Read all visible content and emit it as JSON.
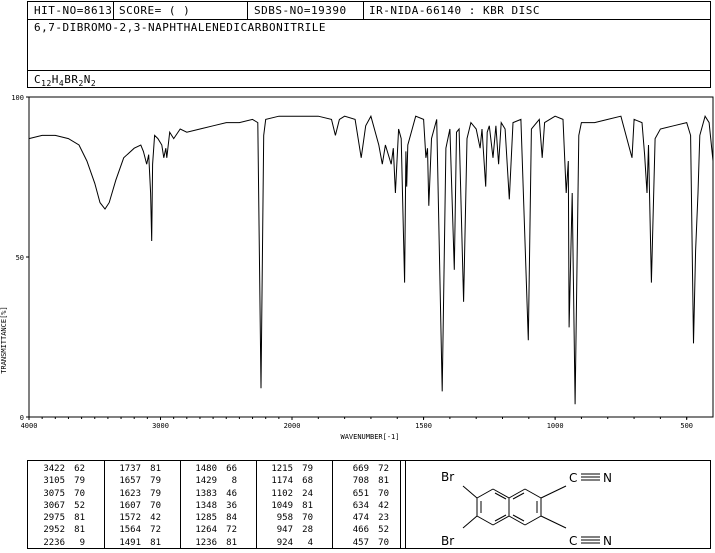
{
  "header": {
    "hit_no": "HIT-NO=8613",
    "score": "SCORE=  (  )",
    "sdbs_no": "SDBS-NO=19390",
    "sample": "IR-NIDA-66140 : KBR DISC",
    "compound_name": "6,7-DIBROMO-2,3-NAPHTHALENEDICARBONITRILE",
    "formula_parts": [
      "C",
      "12",
      "H",
      "4",
      "BR",
      "2",
      "N",
      "2"
    ]
  },
  "chart_data": {
    "type": "line",
    "xlabel": "WAVENUMBER[-1]",
    "ylabel": "TRANSMITTANCE[%]",
    "xlim": [
      4000,
      400
    ],
    "ylim": [
      0,
      100
    ],
    "x_ticks": [
      4000,
      3000,
      2000,
      1500,
      1000,
      500
    ],
    "y_ticks": [
      0,
      50,
      100
    ],
    "series": [
      {
        "points": [
          [
            4000,
            87
          ],
          [
            3900,
            88
          ],
          [
            3800,
            88
          ],
          [
            3700,
            87
          ],
          [
            3620,
            85
          ],
          [
            3560,
            80
          ],
          [
            3500,
            73
          ],
          [
            3460,
            67
          ],
          [
            3422,
            65
          ],
          [
            3390,
            67
          ],
          [
            3340,
            74
          ],
          [
            3280,
            81
          ],
          [
            3200,
            84
          ],
          [
            3150,
            85
          ],
          [
            3130,
            83
          ],
          [
            3105,
            79
          ],
          [
            3090,
            82
          ],
          [
            3075,
            70
          ],
          [
            3067,
            55
          ],
          [
            3060,
            79
          ],
          [
            3045,
            88
          ],
          [
            3020,
            87
          ],
          [
            2990,
            85
          ],
          [
            2975,
            81
          ],
          [
            2960,
            84
          ],
          [
            2952,
            81
          ],
          [
            2930,
            89
          ],
          [
            2900,
            87
          ],
          [
            2850,
            90
          ],
          [
            2800,
            89
          ],
          [
            2700,
            90
          ],
          [
            2600,
            91
          ],
          [
            2500,
            92
          ],
          [
            2400,
            92
          ],
          [
            2300,
            93
          ],
          [
            2260,
            92
          ],
          [
            2236,
            9
          ],
          [
            2215,
            88
          ],
          [
            2200,
            93
          ],
          [
            2100,
            94
          ],
          [
            2000,
            94
          ],
          [
            1900,
            94
          ],
          [
            1850,
            93
          ],
          [
            1835,
            88
          ],
          [
            1820,
            93
          ],
          [
            1800,
            94
          ],
          [
            1760,
            93
          ],
          [
            1737,
            81
          ],
          [
            1720,
            91
          ],
          [
            1700,
            94
          ],
          [
            1670,
            85
          ],
          [
            1657,
            79
          ],
          [
            1645,
            85
          ],
          [
            1623,
            79
          ],
          [
            1615,
            84
          ],
          [
            1607,
            70
          ],
          [
            1595,
            90
          ],
          [
            1585,
            87
          ],
          [
            1572,
            42
          ],
          [
            1567,
            83
          ],
          [
            1564,
            72
          ],
          [
            1560,
            85
          ],
          [
            1530,
            94
          ],
          [
            1500,
            93
          ],
          [
            1491,
            81
          ],
          [
            1485,
            84
          ],
          [
            1480,
            66
          ],
          [
            1470,
            87
          ],
          [
            1450,
            93
          ],
          [
            1429,
            8
          ],
          [
            1415,
            84
          ],
          [
            1400,
            90
          ],
          [
            1383,
            46
          ],
          [
            1375,
            89
          ],
          [
            1365,
            90
          ],
          [
            1348,
            36
          ],
          [
            1335,
            87
          ],
          [
            1320,
            92
          ],
          [
            1300,
            90
          ],
          [
            1285,
            84
          ],
          [
            1278,
            90
          ],
          [
            1264,
            72
          ],
          [
            1258,
            89
          ],
          [
            1250,
            91
          ],
          [
            1236,
            81
          ],
          [
            1225,
            91
          ],
          [
            1215,
            79
          ],
          [
            1205,
            92
          ],
          [
            1190,
            90
          ],
          [
            1174,
            68
          ],
          [
            1160,
            92
          ],
          [
            1130,
            93
          ],
          [
            1102,
            24
          ],
          [
            1090,
            90
          ],
          [
            1060,
            93
          ],
          [
            1049,
            81
          ],
          [
            1040,
            92
          ],
          [
            1000,
            94
          ],
          [
            970,
            93
          ],
          [
            958,
            70
          ],
          [
            950,
            80
          ],
          [
            947,
            28
          ],
          [
            935,
            70
          ],
          [
            924,
            4
          ],
          [
            910,
            88
          ],
          [
            900,
            92
          ],
          [
            850,
            92
          ],
          [
            800,
            93
          ],
          [
            750,
            94
          ],
          [
            708,
            81
          ],
          [
            700,
            93
          ],
          [
            670,
            92
          ],
          [
            660,
            82
          ],
          [
            651,
            70
          ],
          [
            645,
            85
          ],
          [
            634,
            42
          ],
          [
            620,
            87
          ],
          [
            600,
            90
          ],
          [
            550,
            91
          ],
          [
            500,
            92
          ],
          [
            485,
            88
          ],
          [
            474,
            23
          ],
          [
            466,
            52
          ],
          [
            457,
            70
          ],
          [
            450,
            88
          ],
          [
            430,
            94
          ],
          [
            415,
            92
          ],
          [
            405,
            84
          ],
          [
            400,
            80
          ]
        ]
      }
    ]
  },
  "peak_table": {
    "columns": [
      [
        [
          "3422",
          "62"
        ],
        [
          "3105",
          "79"
        ],
        [
          "3075",
          "70"
        ],
        [
          "3067",
          "52"
        ],
        [
          "2975",
          "81"
        ],
        [
          "2952",
          "81"
        ],
        [
          "2236",
          "9"
        ]
      ],
      [
        [
          "1737",
          "81"
        ],
        [
          "1657",
          "79"
        ],
        [
          "1623",
          "79"
        ],
        [
          "1607",
          "70"
        ],
        [
          "1572",
          "42"
        ],
        [
          "1564",
          "72"
        ],
        [
          "1491",
          "81"
        ]
      ],
      [
        [
          "1480",
          "66"
        ],
        [
          "1429",
          "8"
        ],
        [
          "1383",
          "46"
        ],
        [
          "1348",
          "36"
        ],
        [
          "1285",
          "84"
        ],
        [
          "1264",
          "72"
        ],
        [
          "1236",
          "81"
        ]
      ],
      [
        [
          "1215",
          "79"
        ],
        [
          "1174",
          "68"
        ],
        [
          "1102",
          "24"
        ],
        [
          "1049",
          "81"
        ],
        [
          "958",
          "70"
        ],
        [
          "947",
          "28"
        ],
        [
          "924",
          "4"
        ]
      ],
      [
        [
          "669",
          "72"
        ],
        [
          "708",
          "81"
        ],
        [
          "651",
          "70"
        ],
        [
          "634",
          "42"
        ],
        [
          "474",
          "23"
        ],
        [
          "466",
          "52"
        ],
        [
          "457",
          "70"
        ]
      ]
    ]
  },
  "structure": {
    "atoms": [
      "Br",
      "Br",
      "C",
      "N",
      "C",
      "N"
    ]
  }
}
